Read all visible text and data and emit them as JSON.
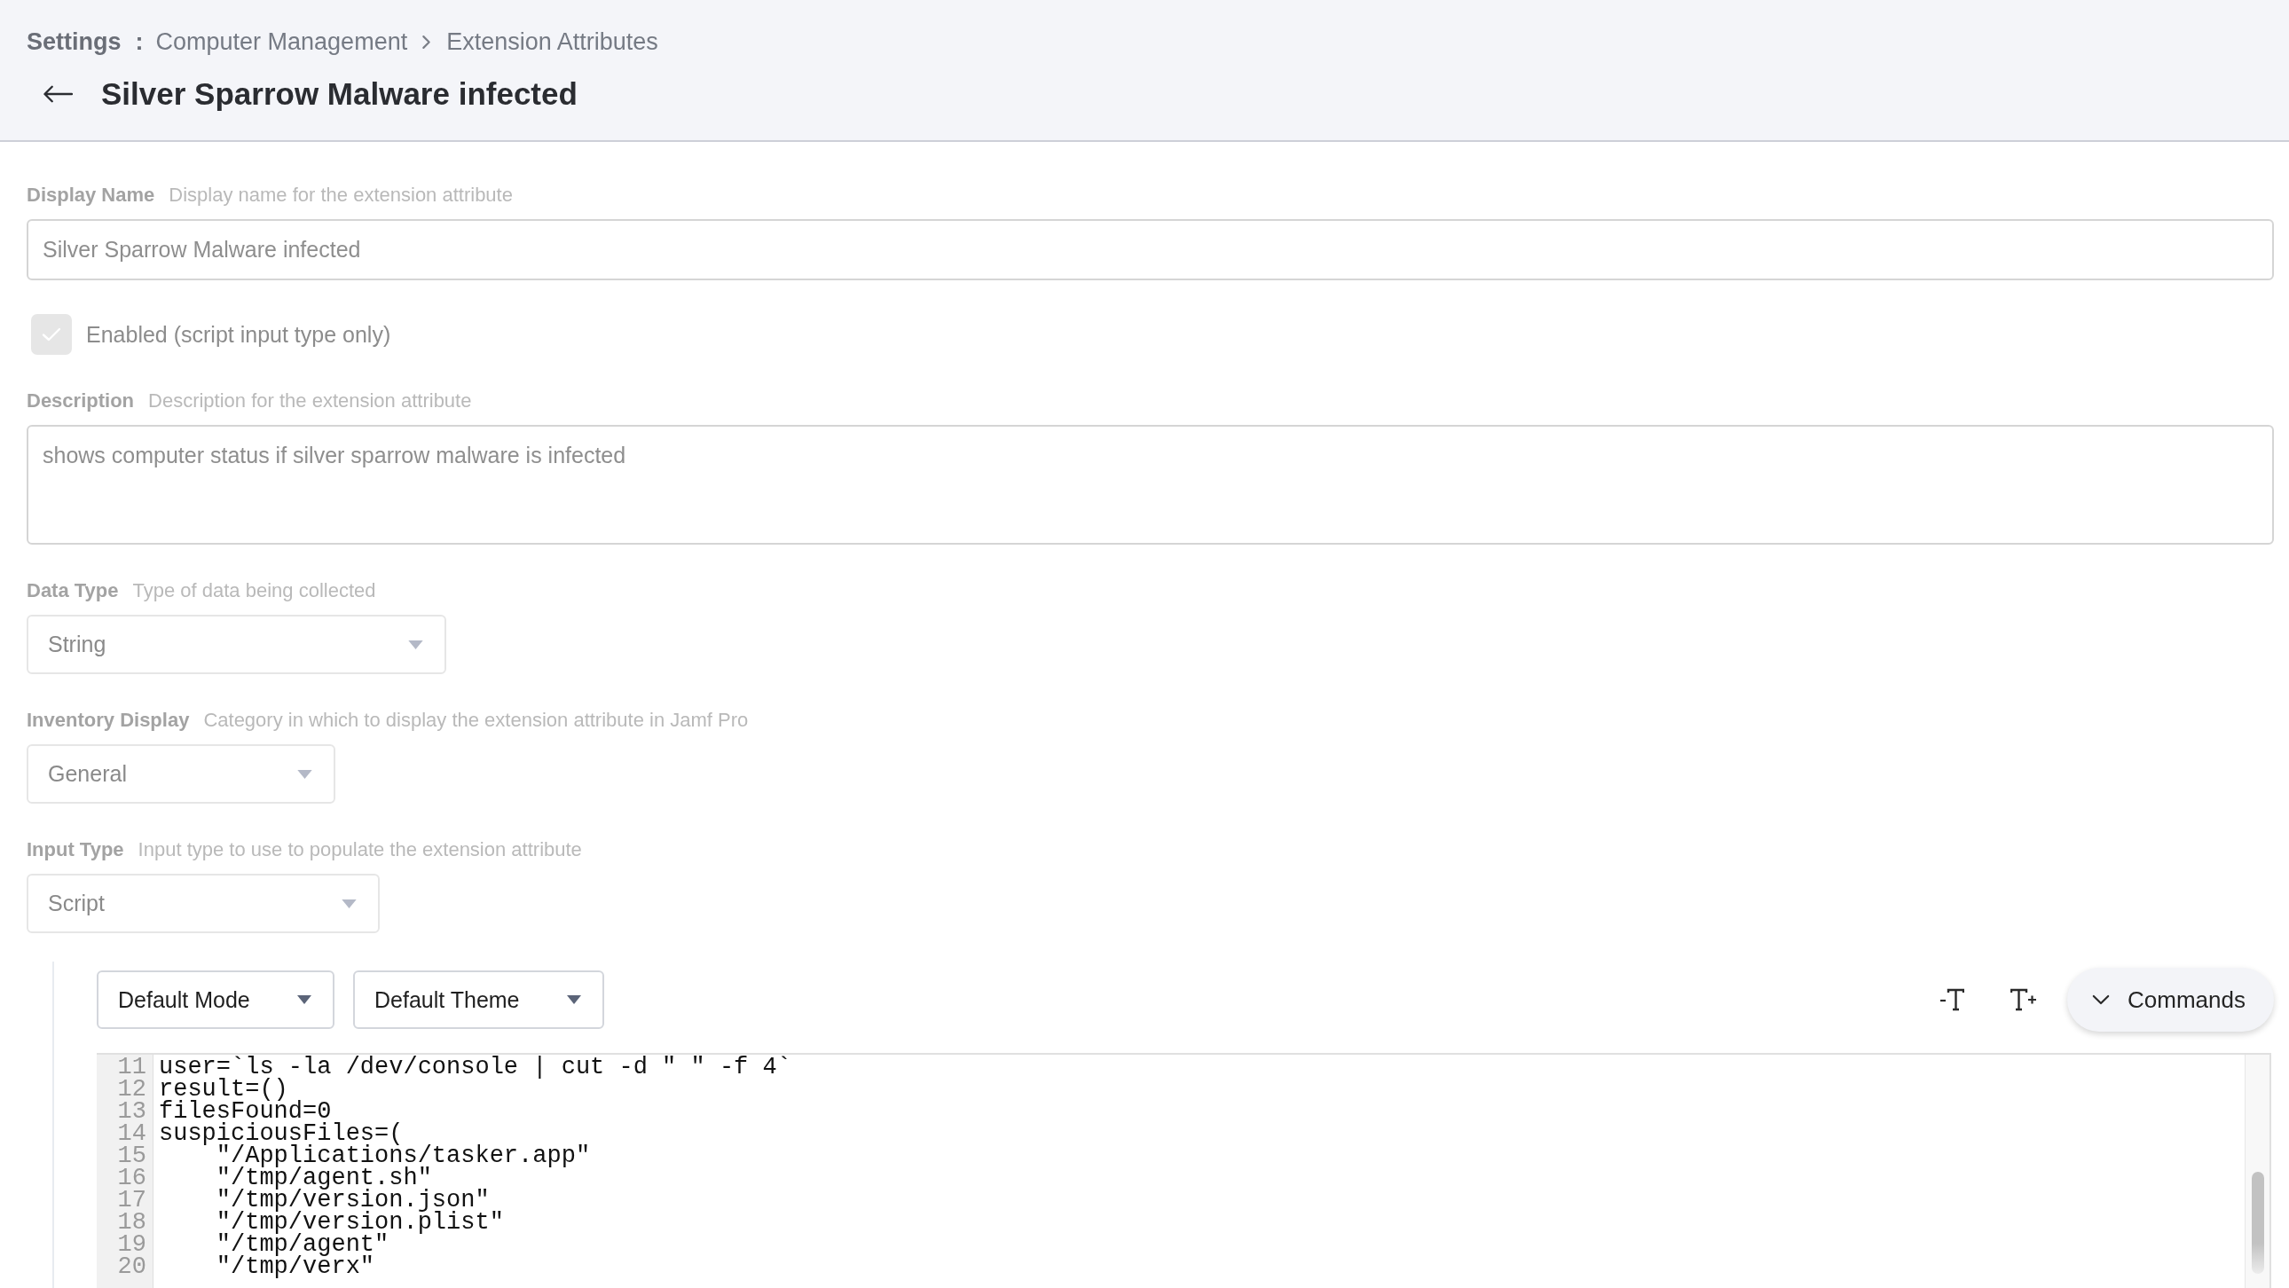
{
  "breadcrumb": {
    "root": "Settings",
    "separator": ":",
    "items": [
      "Computer Management",
      "Extension Attributes"
    ]
  },
  "page_title": "Silver Sparrow Malware infected",
  "fields": [
    {
      "kind": "text",
      "label": "Display Name",
      "hint": "Display name for the extension attribute",
      "value": "Silver Sparrow Malware infected"
    },
    {
      "kind": "checkbox",
      "label": "Enabled (script input type only)",
      "checked": true,
      "disabled": true
    },
    {
      "kind": "textarea",
      "label": "Description",
      "hint": "Description for the extension attribute",
      "value": "shows computer status if silver sparrow malware is infected"
    },
    {
      "kind": "select",
      "label": "Data Type",
      "hint": "Type of data being collected",
      "value": "String"
    },
    {
      "kind": "select",
      "label": "Inventory Display",
      "hint": "Category in which to display the extension attribute in Jamf Pro",
      "value": "General"
    },
    {
      "kind": "select",
      "label": "Input Type",
      "hint": "Input type to use to populate the extension attribute",
      "value": "Script"
    }
  ],
  "editor": {
    "mode_select": "Default Mode",
    "theme_select": "Default Theme",
    "commands_button": "Commands",
    "lines": [
      {
        "number": "11",
        "code": "user=`ls -la /dev/console | cut -d \" \" -f 4`"
      },
      {
        "number": "12",
        "code": "result=()"
      },
      {
        "number": "13",
        "code": "filesFound=0"
      },
      {
        "number": "14",
        "code": "suspiciousFiles=("
      },
      {
        "number": "15",
        "code": "    \"/Applications/tasker.app\""
      },
      {
        "number": "16",
        "code": "    \"/tmp/agent.sh\""
      },
      {
        "number": "17",
        "code": "    \"/tmp/version.json\""
      },
      {
        "number": "18",
        "code": "    \"/tmp/version.plist\""
      },
      {
        "number": "19",
        "code": "    \"/tmp/agent\""
      },
      {
        "number": "20",
        "code": "    \"/tmp/verx\""
      }
    ]
  }
}
